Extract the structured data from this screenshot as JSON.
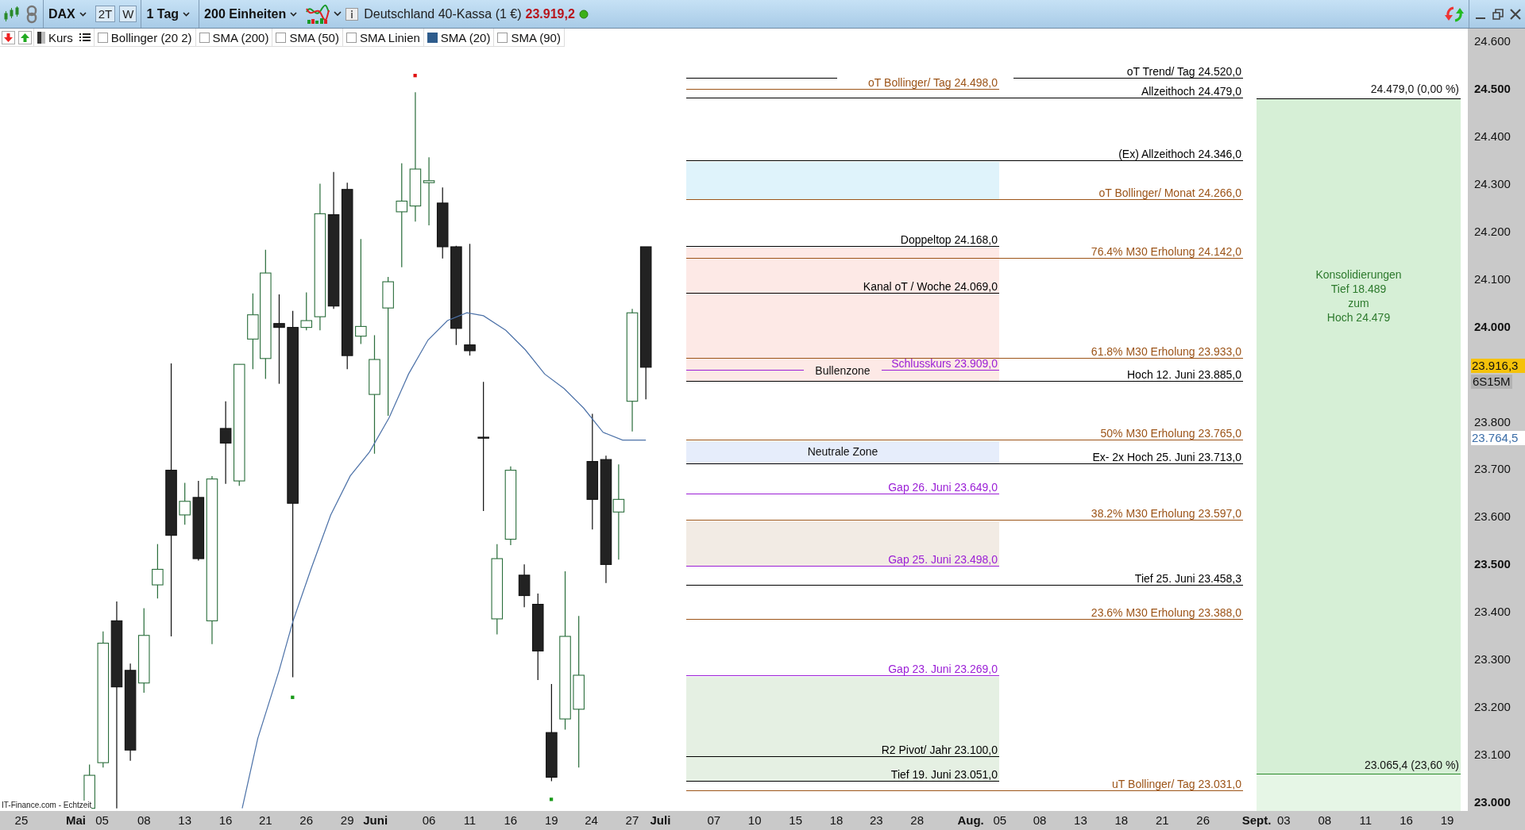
{
  "toolbar": {
    "symbol": "DAX",
    "view_buttons": [
      {
        "label": "2T"
      },
      {
        "label": "W"
      }
    ],
    "period": "1 Tag",
    "units": "200 Einheiten",
    "instrument": "Deutschland 40-Kassa (1 €)",
    "price": "23.919,2"
  },
  "indicators": [
    {
      "kind": "price",
      "label": "Kurs"
    },
    {
      "kind": "check",
      "label": "Bollinger (20 2)",
      "checked": false
    },
    {
      "kind": "check",
      "label": "SMA (200)",
      "checked": false
    },
    {
      "kind": "check",
      "label": "SMA (50)",
      "checked": false
    },
    {
      "kind": "check",
      "label": "SMA Linien",
      "checked": false
    },
    {
      "kind": "check",
      "label": "SMA (20)",
      "checked": true
    },
    {
      "kind": "check",
      "label": "SMA (90)",
      "checked": false
    }
  ],
  "zones": [
    {
      "color": "#dff3fb"
    },
    {
      "color": "#fde9e6",
      "label": "Bullenzone"
    },
    {
      "color": "#e6edfb",
      "label": "Neutrale Zone"
    },
    {
      "color": "#f2ebe4"
    },
    {
      "color": "#e5f0e3"
    }
  ],
  "levels": [
    {
      "kind": "right",
      "label": "oT Trend/ Tag  24.520,0",
      "color": "#000000"
    },
    {
      "kind": "left",
      "label": "oT Bollinger/ Tag 24.498,0",
      "color": "#9c5418"
    },
    {
      "kind": "right",
      "label": "Allzeithoch 24.479,0",
      "color": "#000000"
    },
    {
      "kind": "right",
      "label": "(Ex) Allzeithoch 24.346,0",
      "color": "#000000"
    },
    {
      "kind": "right",
      "label": "oT Bollinger/ Monat 24.266,0",
      "color": "#9c5418"
    },
    {
      "kind": "left",
      "label": "Doppeltop 24.168,0",
      "color": "#000000"
    },
    {
      "kind": "right",
      "label": "76.4% M30 Erholung 24.142,0",
      "color": "#9c5418"
    },
    {
      "kind": "left",
      "label": "Kanal oT / Woche 24.069,0",
      "color": "#000000"
    },
    {
      "kind": "right",
      "label": "61.8% M30 Erholung 23.933,0",
      "color": "#9c5418"
    },
    {
      "kind": "left",
      "label": "Schlusskurs 23.909,0",
      "color": "#9b1fd6"
    },
    {
      "kind": "right",
      "label": "Hoch 12. Juni 23.885,0",
      "color": "#000000"
    },
    {
      "kind": "right",
      "label": "50% M30 Erholung 23.765,0",
      "color": "#9c5418"
    },
    {
      "kind": "right",
      "label": "Ex- 2x Hoch 25. Juni 23.713,0",
      "color": "#000000"
    },
    {
      "kind": "left",
      "label": "Gap 26. Juni 23.649,0",
      "color": "#9b1fd6"
    },
    {
      "kind": "right",
      "label": "38.2% M30 Erholung 23.597,0",
      "color": "#9c5418"
    },
    {
      "kind": "left",
      "label": "Gap 25. Juni 23.498,0",
      "color": "#9b1fd6"
    },
    {
      "kind": "right",
      "label": "Tief 25. Juni 23.458,3",
      "color": "#000000"
    },
    {
      "kind": "right",
      "label": "23.6% M30 Erholung 23.388,0",
      "color": "#9c5418"
    },
    {
      "kind": "left",
      "label": "Gap 23. Juni 23.269,0",
      "color": "#9b1fd6"
    },
    {
      "kind": "left",
      "label": "R2 Pivot/ Jahr 23.100,0",
      "color": "#000000"
    },
    {
      "kind": "left",
      "label": "Tief 19. Juni 23.051,0",
      "color": "#000000"
    },
    {
      "kind": "right",
      "label": "uT Bollinger/ Tag 23.031,0",
      "color": "#9c5418"
    }
  ],
  "consolidation": {
    "top_label": "24.479,0 (0,00 %)",
    "bottom_label": "23.065,4 (23,60 %)",
    "text": [
      "Konsolidierungen",
      "Tief 18.489",
      "zum",
      "Hoch 24.479"
    ]
  },
  "source_note": "IT-Finance.com - Echtzeit",
  "price_axis": {
    "ticks": [
      {
        "label": "24.600",
        "major": false
      },
      {
        "label": "24.500",
        "major": true
      },
      {
        "label": "24.400",
        "major": false
      },
      {
        "label": "24.300",
        "major": false
      },
      {
        "label": "24.200",
        "major": false
      },
      {
        "label": "24.100",
        "major": false
      },
      {
        "label": "24.000",
        "major": true
      },
      {
        "label": "23.800",
        "major": false
      },
      {
        "label": "23.700",
        "major": false
      },
      {
        "label": "23.600",
        "major": false
      },
      {
        "label": "23.500",
        "major": true
      },
      {
        "label": "23.400",
        "major": false
      },
      {
        "label": "23.300",
        "major": false
      },
      {
        "label": "23.200",
        "major": false
      },
      {
        "label": "23.100",
        "major": false
      },
      {
        "label": "23.000",
        "major": true
      }
    ],
    "current_price": "23.916,3",
    "countdown": "6S15M",
    "marker": "23.764,5"
  },
  "time_axis": [
    {
      "label": "25",
      "major": false
    },
    {
      "label": "Mai",
      "major": true
    },
    {
      "label": "05",
      "major": false
    },
    {
      "label": "08",
      "major": false
    },
    {
      "label": "13",
      "major": false
    },
    {
      "label": "16",
      "major": false
    },
    {
      "label": "21",
      "major": false
    },
    {
      "label": "26",
      "major": false
    },
    {
      "label": "29",
      "major": false
    },
    {
      "label": "Juni",
      "major": true
    },
    {
      "label": "06",
      "major": false
    },
    {
      "label": "11",
      "major": false
    },
    {
      "label": "16",
      "major": false
    },
    {
      "label": "19",
      "major": false
    },
    {
      "label": "24",
      "major": false
    },
    {
      "label": "27",
      "major": false
    },
    {
      "label": "Juli",
      "major": true
    },
    {
      "label": "07",
      "major": false
    },
    {
      "label": "10",
      "major": false
    },
    {
      "label": "15",
      "major": false
    },
    {
      "label": "18",
      "major": false
    },
    {
      "label": "23",
      "major": false
    },
    {
      "label": "28",
      "major": false
    },
    {
      "label": "Aug.",
      "major": true
    },
    {
      "label": "05",
      "major": false
    },
    {
      "label": "08",
      "major": false
    },
    {
      "label": "13",
      "major": false
    },
    {
      "label": "18",
      "major": false
    },
    {
      "label": "21",
      "major": false
    },
    {
      "label": "26",
      "major": false
    },
    {
      "label": "Sept.",
      "major": true
    },
    {
      "label": "03",
      "major": false
    },
    {
      "label": "08",
      "major": false
    },
    {
      "label": "11",
      "major": false
    },
    {
      "label": "16",
      "major": false
    },
    {
      "label": "19",
      "major": false
    }
  ]
}
